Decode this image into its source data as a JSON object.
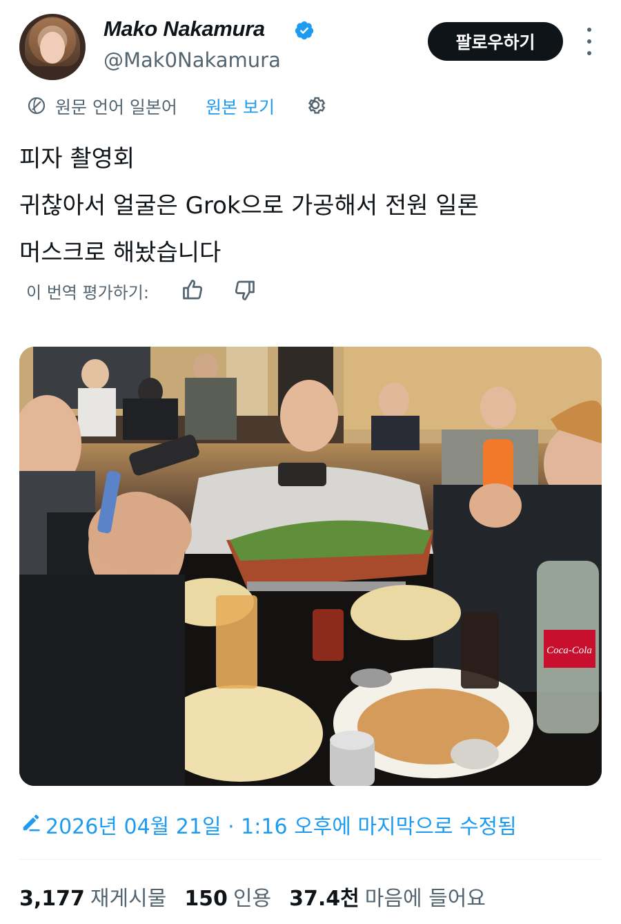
{
  "header": {
    "display_name": "Mako Nakamura",
    "handle": "@Mak0Nakamura",
    "follow_label": "팔로우하기",
    "verified": true
  },
  "translation": {
    "source_text": "원문 언어 일본어",
    "view_original_label": "원본 보기"
  },
  "tweet": {
    "lines": [
      "피자 촬영회",
      "귀찮아서 얼굴은 Grok으로 가공해서 전원 일론",
      "머스크로 해놨습니다"
    ]
  },
  "rating": {
    "prompt": "이 번역 평가하기:"
  },
  "media": {
    "label_bottle": "Coca-Cola"
  },
  "edited": {
    "text": "2026년 04월 21일 · 1:16 오후에 마지막으로 수정됨"
  },
  "stats": {
    "reposts_count": "3,177",
    "reposts_label": "재게시물",
    "quotes_count": "150",
    "quotes_label": "인용",
    "likes_count": "37.4천",
    "likes_label": "마음에 들어요"
  },
  "colors": {
    "accent": "#1d9bf0",
    "text_primary": "#0f1419",
    "text_secondary": "#536471",
    "button_bg": "#0f1419"
  }
}
